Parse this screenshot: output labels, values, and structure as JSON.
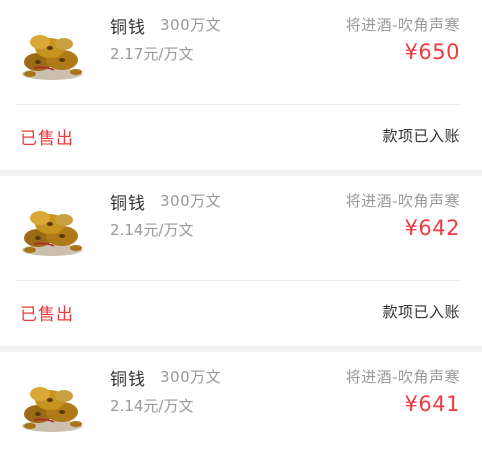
{
  "orders": [
    {
      "item": "铜钱",
      "quantity": "300万文",
      "unit_price": "2.17元/万文",
      "server": "将进酒-吹角声寒",
      "price": "¥650",
      "status": "已售出",
      "settlement": "款项已入账",
      "thumbnail_icon": "copper-coins-icon"
    },
    {
      "item": "铜钱",
      "quantity": "300万文",
      "unit_price": "2.14元/万文",
      "server": "将进酒-吹角声寒",
      "price": "¥642",
      "status": "已售出",
      "settlement": "款项已入账",
      "thumbnail_icon": "copper-coins-icon"
    },
    {
      "item": "铜钱",
      "quantity": "300万文",
      "unit_price": "2.14元/万文",
      "server": "将进酒-吹角声寒",
      "price": "¥641",
      "thumbnail_icon": "copper-coins-icon"
    }
  ],
  "colors": {
    "accent_red": "#f0383f",
    "text_primary": "#333333",
    "text_secondary": "#999999",
    "background": "#f2f2f2"
  }
}
